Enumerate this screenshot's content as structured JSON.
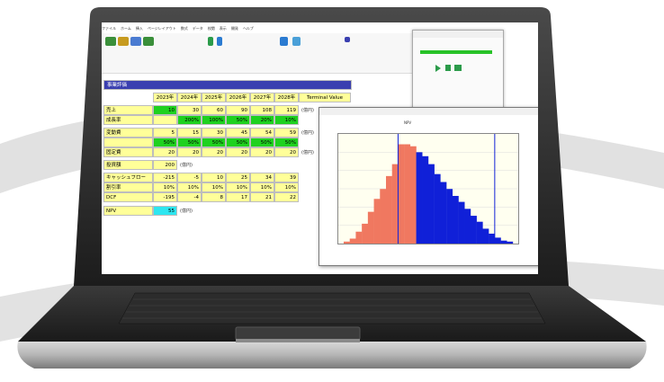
{
  "colors": {
    "title_bar": "#3a3fb0",
    "cell_yellow": "#ffff99",
    "cell_green": "#1fd11f",
    "cell_cyan": "#2ee6f0",
    "hist_red": "#f07860",
    "hist_blue": "#1020d8"
  },
  "spreadsheet": {
    "section_title": "事業評価",
    "years": [
      "2023年",
      "2024年",
      "2025年",
      "2026年",
      "2027年",
      "2028年",
      "Terminal Value"
    ],
    "unit_label": "(億円)",
    "rows": [
      {
        "label": "売上",
        "values": [
          "10",
          "30",
          "60",
          "90",
          "108",
          "119"
        ],
        "unit": "(億円)"
      },
      {
        "label": "成長率",
        "values": [
          "",
          "200%",
          "100%",
          "50%",
          "20%",
          "10%"
        ],
        "unit": ""
      },
      {
        "label": "変動費",
        "values": [
          "5",
          "15",
          "30",
          "45",
          "54",
          "59"
        ],
        "unit": "(億円)"
      },
      {
        "label": "",
        "values": [
          "50%",
          "50%",
          "50%",
          "50%",
          "50%",
          "50%"
        ],
        "unit": ""
      },
      {
        "label": "固定費",
        "values": [
          "20",
          "20",
          "20",
          "20",
          "20",
          "20"
        ],
        "unit": "(億円)"
      },
      {
        "label": "投資額",
        "values": [
          "200"
        ],
        "unit": "(億円)"
      },
      {
        "label": "キャッシュフロー",
        "values": [
          "-215",
          "-5",
          "10",
          "25",
          "34",
          "39"
        ],
        "unit": ""
      },
      {
        "label": "割引率",
        "values": [
          "10%",
          "10%",
          "10%",
          "10%",
          "10%",
          "10%"
        ],
        "unit": ""
      },
      {
        "label": "DCF",
        "values": [
          "-195",
          "-4",
          "8",
          "17",
          "21",
          "22"
        ],
        "unit": ""
      },
      {
        "label": "NPV",
        "values": [
          "55"
        ],
        "unit": "(億円)"
      }
    ]
  },
  "chart_window": {
    "series_label": "NPV"
  },
  "chart_data": {
    "type": "bar",
    "series": [
      {
        "name": "",
        "values": [
          2,
          5,
          12,
          20,
          32,
          45,
          55,
          68,
          80,
          100,
          100,
          98
        ]
      },
      {
        "name": "",
        "values": [
          92,
          88,
          80,
          70,
          62,
          55,
          48,
          42,
          35,
          28,
          22,
          15,
          10,
          6,
          3,
          2
        ]
      }
    ]
  }
}
